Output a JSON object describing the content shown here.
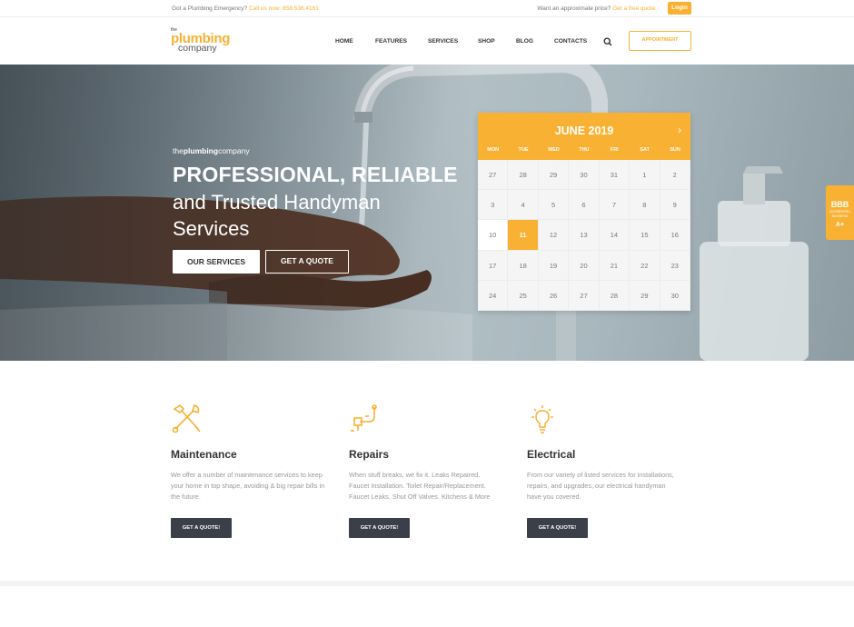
{
  "topbar": {
    "emergency_text": "Got a Plumbing Emergency?",
    "phone_text": "Call us now: 858.536.4161",
    "price_text": "Want an approximate price?",
    "quote_link": "Get a free quote.",
    "login_label": "Login"
  },
  "logo": {
    "the": "the",
    "plumbing": "plumbing",
    "company": "company"
  },
  "nav": {
    "items": [
      "HOME",
      "FEATURES",
      "SERVICES",
      "SHOP",
      "BLOG",
      "CONTACTS"
    ],
    "appointment_label": "APPOINTMENT",
    "search_icon": "search-icon"
  },
  "hero": {
    "sub_the": "the",
    "sub_plumbing": "plumbing",
    "sub_company": "company",
    "heading_line1": "PROFESSIONAL, RELIABLE",
    "heading_line2": "and Trusted Handyman Services",
    "services_button": "OUR SERVICES",
    "quote_button": "GET A QUOTE"
  },
  "calendar": {
    "month": "JUNE 2019",
    "next_icon": "chevron-right-icon",
    "days": [
      "MON",
      "TUE",
      "WED",
      "THU",
      "FRI",
      "SAT",
      "SUN"
    ],
    "weeks": [
      [
        "27",
        "28",
        "29",
        "30",
        "31",
        "1",
        "2"
      ],
      [
        "3",
        "4",
        "5",
        "6",
        "7",
        "8",
        "9"
      ],
      [
        "10",
        "11",
        "12",
        "13",
        "14",
        "15",
        "16"
      ],
      [
        "17",
        "18",
        "19",
        "20",
        "21",
        "22",
        "23"
      ],
      [
        "24",
        "25",
        "26",
        "27",
        "28",
        "29",
        "30"
      ]
    ],
    "selected": "11"
  },
  "bbb": {
    "mark": "BBB",
    "line1": "ACCREDITED",
    "line2": "BUSINESS",
    "grade": "A+"
  },
  "services": [
    {
      "icon": "wrench-screwdriver-icon",
      "title": "Maintenance",
      "text": "We offer a number of maintenance services to keep your home in top shape, avoiding & big repair bills in the future.",
      "button": "GET A QUOTE!"
    },
    {
      "icon": "pipe-faucet-icon",
      "title": "Repairs",
      "text": "When stuff breaks, we fix it. Leaks Repaired. Faucet Installation. Toilet Repair/Replacement. Faucet Leaks. Shut Off Valves. Kitchens & More",
      "button": "GET A QUOTE!"
    },
    {
      "icon": "lightbulb-icon",
      "title": "Electrical",
      "text": "From our variety of listed services for installations, repairs, and upgrades, our electrical handyman have you covered.",
      "button": "GET A QUOTE!"
    }
  ],
  "colors": {
    "accent": "#f8b133",
    "dark_button": "#3a3f4a"
  }
}
